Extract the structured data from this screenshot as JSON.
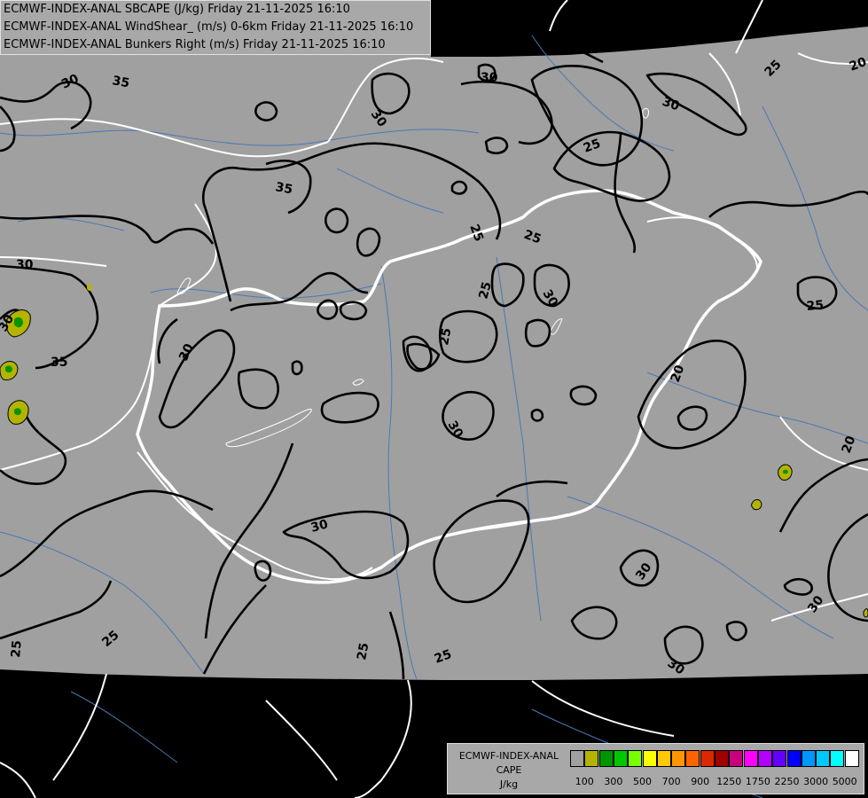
{
  "title_lines": [
    "ECMWF-INDEX-ANAL SBCAPE (J/kg) Friday 21-11-2025 16:10",
    "ECMWF-INDEX-ANAL WindShear_ (m/s) 0-6km Friday 21-11-2025 16:10",
    "ECMWF-INDEX-ANAL Bunkers Right (m/s) Friday 21-11-2025 16:10"
  ],
  "legend": {
    "title_lines": [
      "ECMWF-INDEX-ANAL",
      "CAPE",
      "J/kg"
    ],
    "colors": [
      "#a0a0a0",
      "#b4b400",
      "#009600",
      "#00c800",
      "#78ff00",
      "#ffff00",
      "#ffc800",
      "#ff9600",
      "#ff6400",
      "#dc2800",
      "#a00000",
      "#c8007d",
      "#ff00ff",
      "#b400ff",
      "#6400ff",
      "#0000ff",
      "#0096ff",
      "#00c8ff",
      "#00ffff",
      "#ffffff"
    ],
    "tick_labels": [
      "100",
      "300",
      "500",
      "700",
      "900",
      "1250",
      "1750",
      "2250",
      "3000",
      "5000"
    ]
  },
  "colors": {
    "domain_fill": "#a0a0a0",
    "outside": "#000000",
    "border_line": "#ffffff",
    "river_line": "#4a78b4",
    "contour_line": "#000000"
  },
  "contour_labels": [
    {
      "text": "30",
      "value": 30
    },
    {
      "text": "35",
      "value": 35
    },
    {
      "text": "30",
      "value": 30
    },
    {
      "text": "30",
      "value": 30
    },
    {
      "text": "25",
      "value": 25
    },
    {
      "text": "20",
      "value": 20
    },
    {
      "text": "35",
      "value": 35
    },
    {
      "text": "30",
      "value": 30
    },
    {
      "text": "25",
      "value": 25
    },
    {
      "text": "25",
      "value": 25
    },
    {
      "text": "25",
      "value": 25
    },
    {
      "text": "30",
      "value": 30
    },
    {
      "text": "25",
      "value": 25
    },
    {
      "text": "25",
      "value": 25
    },
    {
      "text": "30",
      "value": 30
    },
    {
      "text": "30",
      "value": 30
    },
    {
      "text": "35",
      "value": 35
    },
    {
      "text": "30",
      "value": 30
    },
    {
      "text": "20",
      "value": 20
    },
    {
      "text": "30",
      "value": 30
    },
    {
      "text": "30",
      "value": 30
    },
    {
      "text": "25",
      "value": 25
    },
    {
      "text": "30",
      "value": 30
    },
    {
      "text": "25",
      "value": 25
    },
    {
      "text": "25",
      "value": 25
    },
    {
      "text": "30",
      "value": 30
    },
    {
      "text": "30",
      "value": 30
    },
    {
      "text": "25",
      "value": 25
    },
    {
      "text": "20",
      "value": 20
    },
    {
      "text": "25",
      "value": 25
    }
  ]
}
